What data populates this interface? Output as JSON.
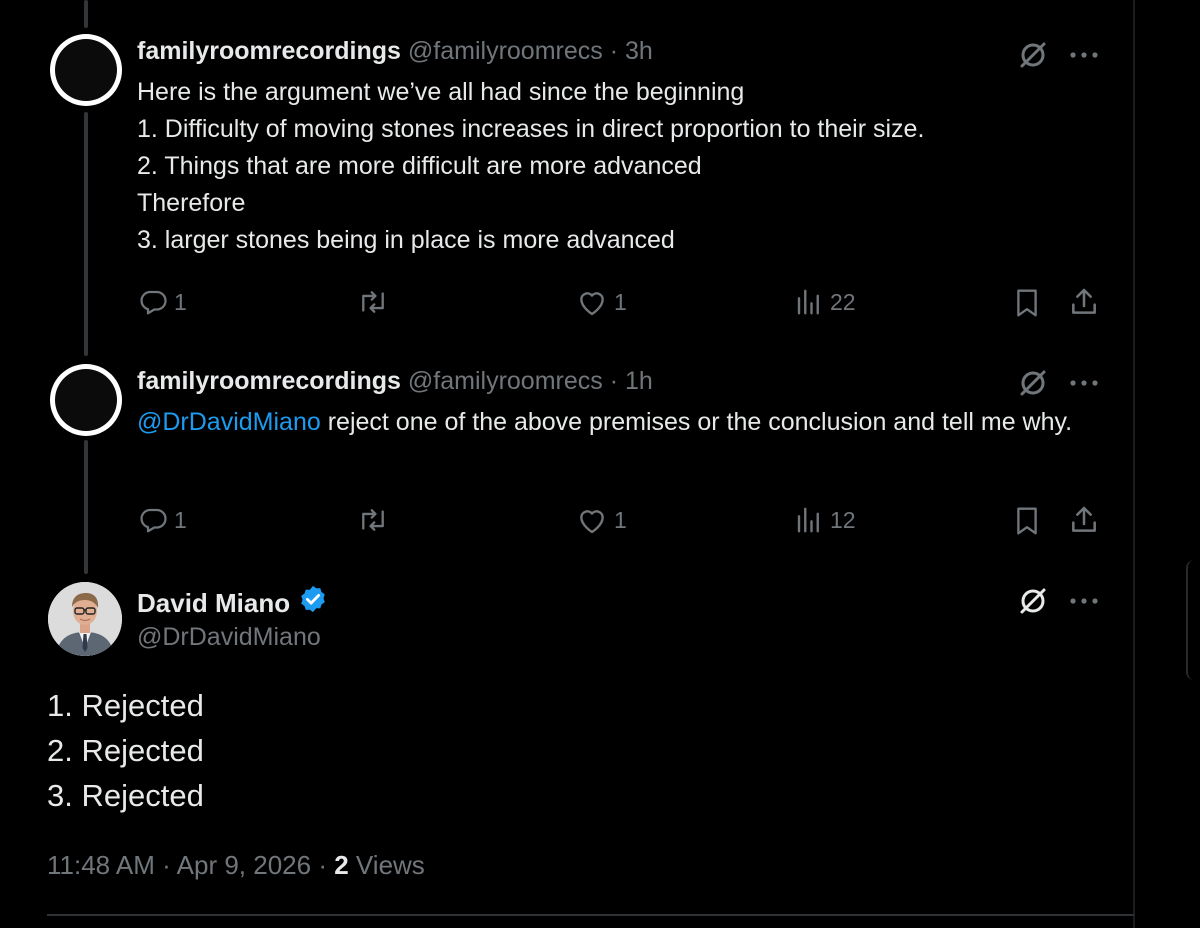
{
  "reply1": {
    "author_name": "familyroomrecordings",
    "handle": "@familyroomrecs",
    "separator": "·",
    "time": "3h",
    "text": "Here is the argument we’ve all had since the beginning\n1. Difficulty of moving stones increases in direct proportion to their size.\n2. Things that are more difficult are more advanced\nTherefore\n3. larger stones being in place is more advanced",
    "replies": "1",
    "likes": "1",
    "views": "22"
  },
  "reply2": {
    "author_name": "familyroomrecordings",
    "handle": "@familyroomrecs",
    "separator": "·",
    "time": "1h",
    "mention": "@DrDavidMiano",
    "text": " reject one of the above premises or the conclusion and tell me why.",
    "replies": "1",
    "likes": "1",
    "views": "12"
  },
  "main_tweet": {
    "author_name": "David Miano",
    "handle": "@DrDavidMiano",
    "lines": [
      "1. Rejected",
      "2. Rejected",
      "3. Rejected"
    ],
    "time": "11:48 AM",
    "separator": "·",
    "date": "Apr 9, 2026",
    "views_count": "2",
    "views_label": "Views"
  },
  "icons": {
    "reply": "reply-icon",
    "retweet": "retweet-icon",
    "like": "heart-icon",
    "views": "views-chart-icon",
    "bookmark": "bookmark-icon",
    "share": "share-icon",
    "grok": "grok-icon",
    "more": "more-icon",
    "verified": "verified-badge-icon"
  },
  "colors": {
    "background": "#000000",
    "text": "#e7e9ea",
    "muted": "#71767b",
    "accent": "#1d9bf0"
  }
}
